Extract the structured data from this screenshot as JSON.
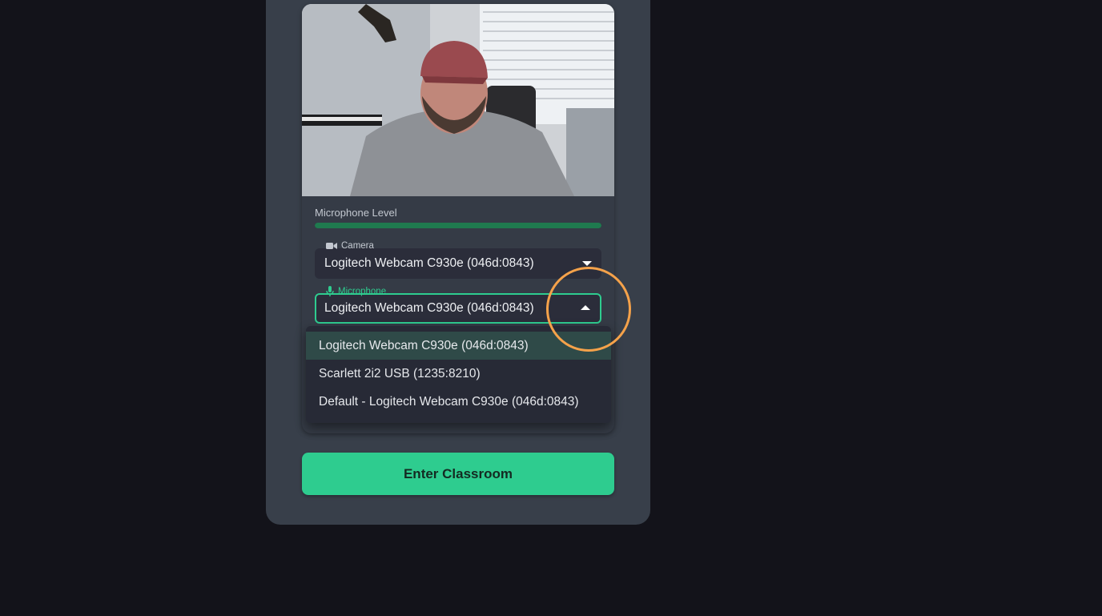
{
  "preview": {
    "microphone_level_label": "Microphone Level",
    "microphone_level": 1.0
  },
  "camera": {
    "label": "Camera",
    "selected": "Logitech Webcam C930e (046d:0843)"
  },
  "microphone": {
    "label": "Microphone",
    "selected": "Logitech Webcam C930e (046d:0843)",
    "options": [
      "Logitech Webcam C930e (046d:0843)",
      "Scarlett 2i2 USB (1235:8210)",
      "Default - Logitech Webcam C930e (046d:0843)"
    ]
  },
  "enter_button": "Enter Classroom",
  "colors": {
    "accent": "#2ecc8f",
    "highlight_ring": "#f5a24a"
  }
}
